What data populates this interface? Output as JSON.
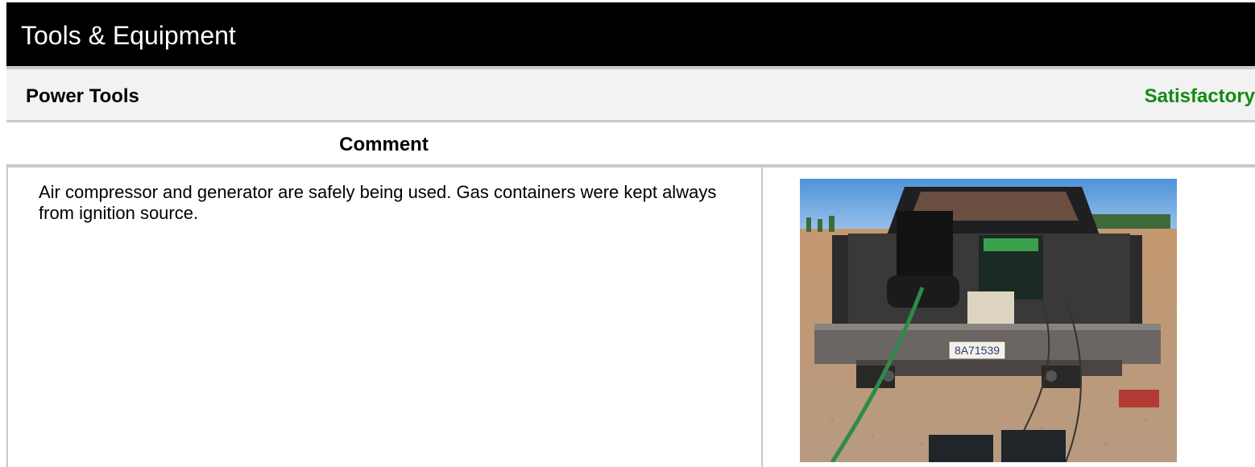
{
  "header": {
    "title": "Tools & Equipment"
  },
  "section": {
    "name": "Power Tools",
    "status": "Satisfactory",
    "status_color": "#138a13"
  },
  "comment": {
    "heading": "Comment",
    "text": "Air compressor and generator are safely being used. Gas containers were kept always from ignition source."
  },
  "photo": {
    "license_plate": "8A71539",
    "icon": "photo-icon"
  }
}
